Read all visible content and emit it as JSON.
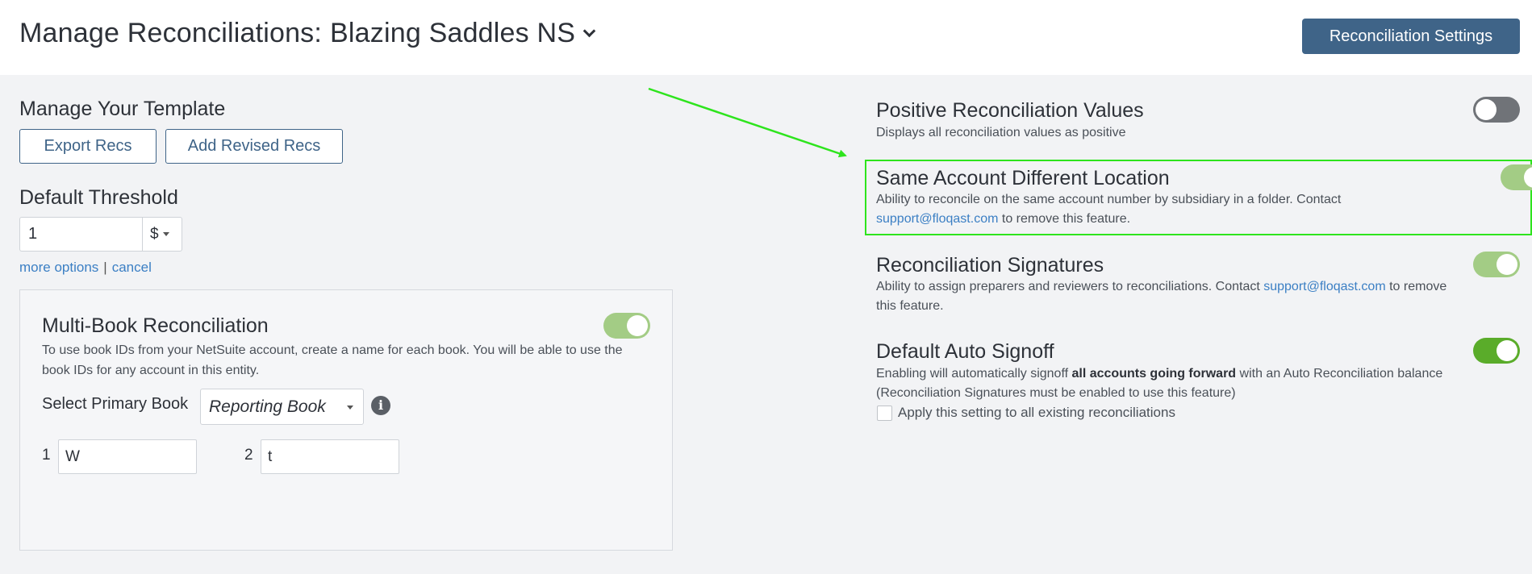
{
  "header": {
    "title": "Manage Reconciliations:",
    "entity": "Blazing Saddles NS",
    "settings_button": "Reconciliation Settings"
  },
  "template": {
    "title": "Manage Your Template",
    "export_button": "Export Recs",
    "add_revised_button": "Add Revised Recs"
  },
  "threshold": {
    "title": "Default Threshold",
    "value": "1",
    "currency": "$",
    "more_options": "more options",
    "separator": "|",
    "cancel": "cancel"
  },
  "multibook": {
    "title": "Multi-Book Reconciliation",
    "description": "To use book IDs from your NetSuite account, create a name for each book. You will be able to use the book IDs for any account in this entity.",
    "primary_label": "Select Primary Book",
    "primary_value": "Reporting Book",
    "info_glyph": "i",
    "toggle_state": "on",
    "books": [
      {
        "number": "1",
        "value": "W"
      },
      {
        "number": "2",
        "value": "t"
      }
    ]
  },
  "features": {
    "positive_values": {
      "title": "Positive Reconciliation Values",
      "description": "Displays all reconciliation values as positive",
      "toggle_state": "off"
    },
    "same_account": {
      "title": "Same Account Different Location",
      "desc_before": "Ability to reconcile on the same account number by subsidiary in a folder. Contact ",
      "email": "support@floqast.com",
      "desc_after": " to remove this feature.",
      "toggle_state": "on"
    },
    "signatures": {
      "title": "Reconciliation Signatures",
      "desc_before": "Ability to assign preparers and reviewers to reconciliations. Contact ",
      "email": "support@floqast.com",
      "desc_after": " to remove this feature.",
      "toggle_state": "on"
    },
    "auto_signoff": {
      "title": "Default Auto Signoff",
      "desc_before": "Enabling will automatically signoff ",
      "desc_bold": "all accounts going forward",
      "desc_after": " with an Auto Reconciliation balance (Reconciliation Signatures must be enabled to use this feature)",
      "checkbox_label": "Apply this setting to all existing reconciliations",
      "toggle_state": "on"
    }
  },
  "colors": {
    "primary_button": "#3f6488",
    "link": "#3b7fc4",
    "toggle_on_light": "#a3cc85",
    "toggle_on_dark": "#5aac2a",
    "toggle_off": "#707378",
    "highlight": "#2ee41d"
  }
}
